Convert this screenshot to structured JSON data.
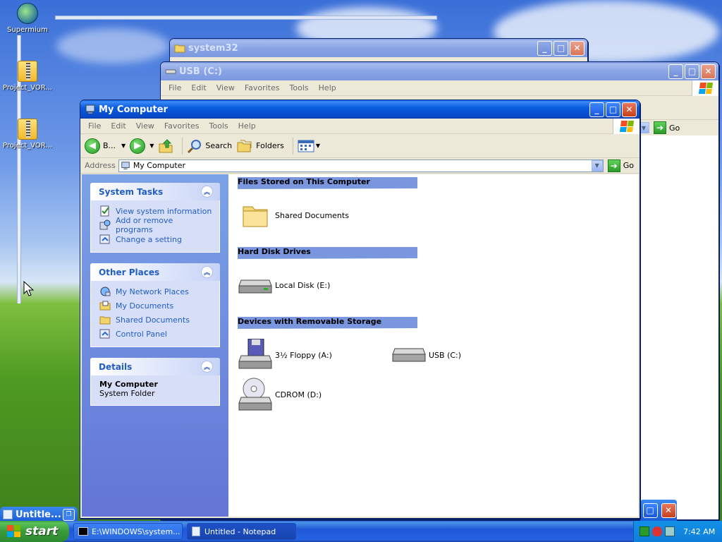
{
  "desktop": {
    "icons": [
      {
        "label": "Supermium",
        "icon": "supermium-icon"
      },
      {
        "label": "Project_VOR...",
        "icon": "zip-folder-icon"
      },
      {
        "label": "Project_VOR...",
        "icon": "zip-folder-icon"
      }
    ]
  },
  "windows": {
    "system32": {
      "title": "system32"
    },
    "usb": {
      "title": "USB (C:)",
      "menu": [
        "File",
        "Edit",
        "View",
        "Favorites",
        "Tools",
        "Help"
      ],
      "go_label": "Go"
    },
    "mycomputer": {
      "title": "My Computer",
      "menu": [
        "File",
        "Edit",
        "View",
        "Favorites",
        "Tools",
        "Help"
      ],
      "toolbar": {
        "back_label": "B...",
        "search_label": "Search",
        "folders_label": "Folders"
      },
      "address": {
        "label": "Address",
        "value": "My Computer",
        "go_label": "Go"
      },
      "system_tasks": {
        "title": "System Tasks",
        "items": [
          "View system information",
          "Add or remove programs",
          "Change a setting"
        ]
      },
      "other_places": {
        "title": "Other Places",
        "items": [
          "My Network Places",
          "My Documents",
          "Shared Documents",
          "Control Panel"
        ]
      },
      "details": {
        "title": "Details",
        "name": "My Computer",
        "type": "System Folder"
      },
      "groups": {
        "files": {
          "title": "Files Stored on This Computer",
          "items": [
            "Shared Documents"
          ]
        },
        "hdd": {
          "title": "Hard Disk Drives",
          "items": [
            "Local Disk (E:)"
          ]
        },
        "removable": {
          "title": "Devices with Removable Storage",
          "items": [
            "3½ Floppy (A:)",
            "USB (C:)",
            "CDROM (D:)"
          ]
        }
      }
    },
    "minimized": {
      "title": "Untitle..."
    }
  },
  "taskbar": {
    "start_label": "start",
    "buttons": [
      "E:\\WINDOWS\\system...",
      "Untitled - Notepad"
    ],
    "clock": "7:42 AM"
  },
  "colors": {
    "title_active": "#0b5ce0",
    "link_blue": "#215dc6",
    "task_pane": "#6f8fde"
  }
}
